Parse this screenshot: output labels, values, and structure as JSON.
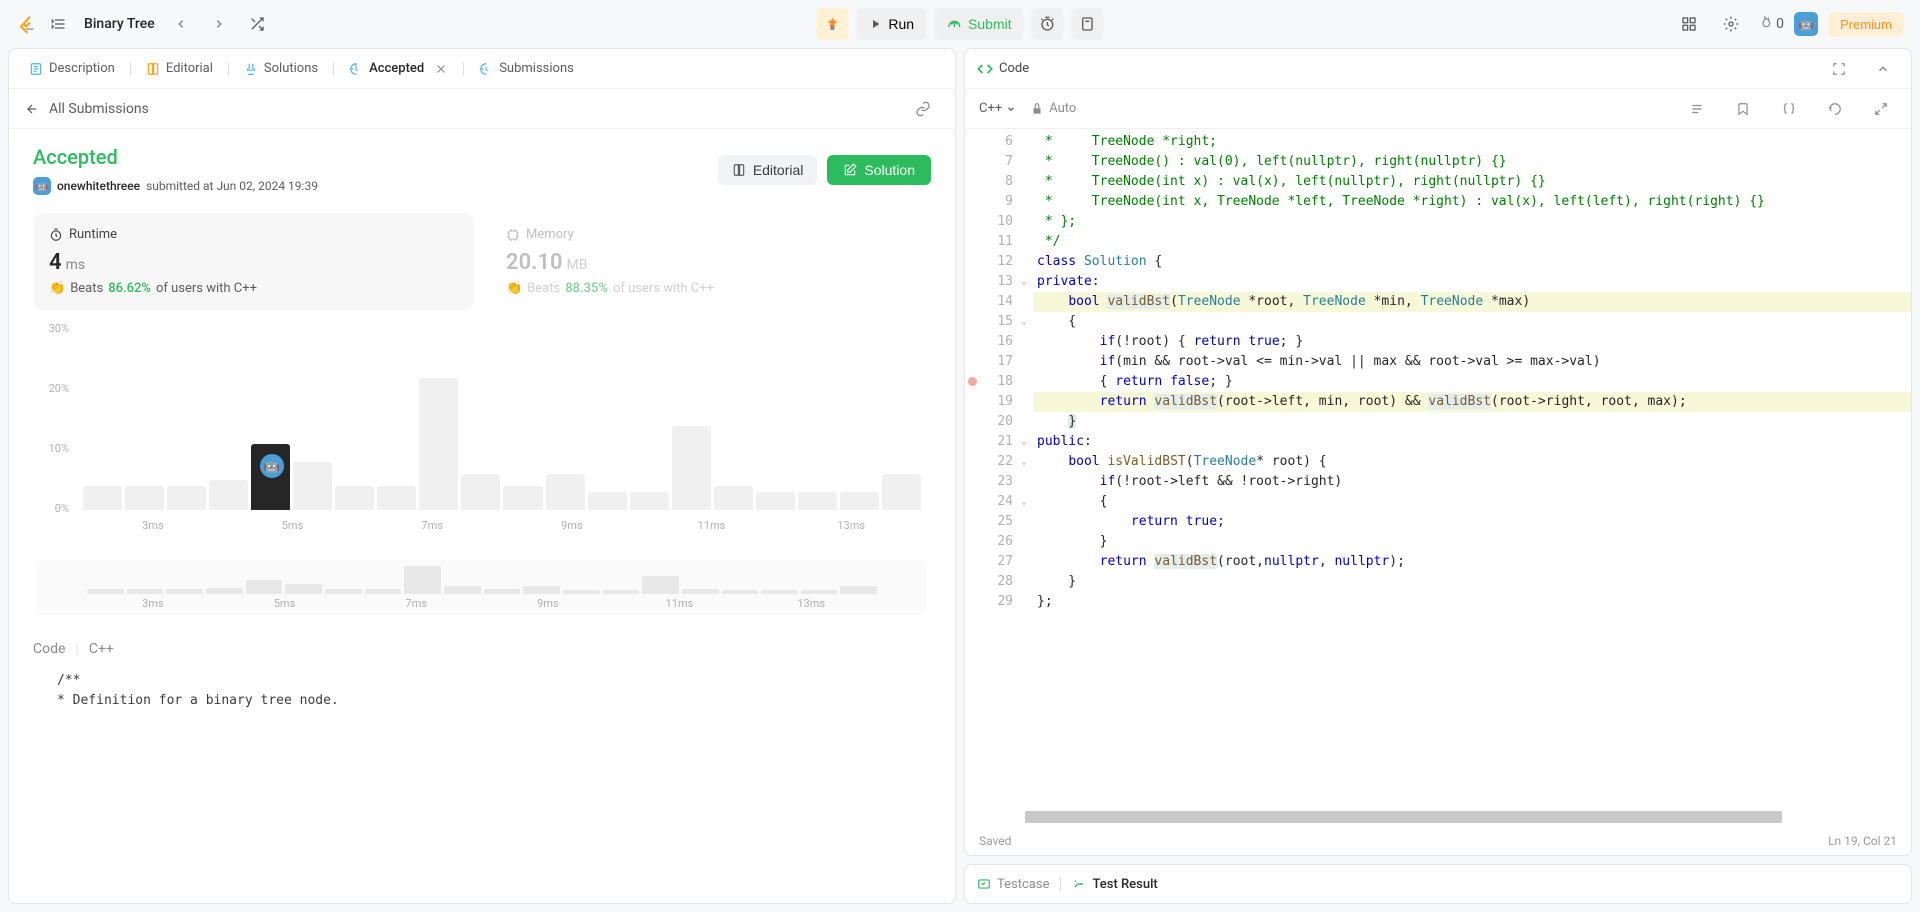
{
  "topbar": {
    "problem_title": "Binary Tree",
    "run_label": "Run",
    "submit_label": "Submit",
    "fire_count": "0",
    "premium_label": "Premium"
  },
  "left": {
    "tabs": {
      "description": "Description",
      "editorial": "Editorial",
      "solutions": "Solutions",
      "accepted": "Accepted",
      "submissions": "Submissions"
    },
    "back_label": "All Submissions",
    "status_title": "Accepted",
    "username": "onewhitethreee",
    "submitted_at": "submitted at Jun 02, 2024 19:39",
    "editorial_btn": "Editorial",
    "solution_btn": "Solution",
    "runtime": {
      "label": "Runtime",
      "value": "4",
      "unit": "ms",
      "beats_label": "Beats",
      "pct": "86.62%",
      "of_users": "of users with C++"
    },
    "memory": {
      "label": "Memory",
      "value": "20.10",
      "unit": "MB",
      "beats_label": "Beats",
      "pct": "88.35%",
      "of_users": "of users with C++"
    },
    "code_label": "Code",
    "lang_label": "C++",
    "snippet_l1": "/**",
    "snippet_l2": " * Definition for a binary tree node."
  },
  "chart_data": {
    "type": "bar",
    "xlabel_unit": "ms",
    "y_ticks": [
      "0%",
      "10%",
      "20%",
      "30%"
    ],
    "x_ticks": [
      "3ms",
      "5ms",
      "7ms",
      "9ms",
      "11ms",
      "13ms"
    ],
    "bars_pct": [
      4,
      4,
      4,
      5,
      11,
      8,
      4,
      4,
      22,
      6,
      4,
      6,
      3,
      3,
      14,
      4,
      3,
      3,
      3,
      6
    ],
    "highlight_index": 4,
    "user_marker_position_index": 4
  },
  "right": {
    "code_title": "Code",
    "lang": "C++",
    "auto_label": "Auto",
    "footer_saved": "Saved",
    "footer_pos": "Ln 19, Col 21",
    "testcase_tab": "Testcase",
    "result_tab": "Test Result",
    "start_line": 6,
    "lines": [
      {
        "t": " *     TreeNode *right;",
        "c": "cm"
      },
      {
        "t": " *     TreeNode() : val(0), left(nullptr), right(nullptr) {}",
        "c": "cm"
      },
      {
        "t": " *     TreeNode(int x) : val(x), left(nullptr), right(nullptr) {}",
        "c": "cm"
      },
      {
        "t": " *     TreeNode(int x, TreeNode *left, TreeNode *right) : val(x), left(left), right(right) {}",
        "c": "cm"
      },
      {
        "t": " * };",
        "c": "cm"
      },
      {
        "t": " */",
        "c": "cm"
      },
      {
        "html": "<span class='kw'>class</span> <span class='type'>Solution</span> {"
      },
      {
        "html": "<span class='kw'>private</span>:",
        "fold": true
      },
      {
        "html": "    <span class='kw'>bool</span> <span class='fn hl-word'>validBst</span>(<span class='type'>TreeNode</span> *root, <span class='type'>TreeNode</span> *min, <span class='type'>TreeNode</span> *max)",
        "hl": true
      },
      {
        "t": "    {",
        "fold": true
      },
      {
        "html": "        <span class='kw'>if</span>(!root) { <span class='kw'>return</span> <span class='kw'>true</span>; }"
      },
      {
        "html": "        <span class='kw'>if</span>(min && root-&gt;val &lt;= min-&gt;val || max && root-&gt;val &gt;= max-&gt;val)"
      },
      {
        "html": "        { <span class='kw'>return</span> <span class='kw'>false</span>; }",
        "bp": true
      },
      {
        "html": "        <span class='kw'>return</span> <span class='fn hl-word'>validBst</span>(root-&gt;left, min, root) && <span class='fn hl-word'>validBst</span>(root-&gt;right, root, max);",
        "hl": true
      },
      {
        "html": "    <span class='hl-word'>}</span>"
      },
      {
        "html": "<span class='kw'>public</span>:",
        "fold": true
      },
      {
        "html": "    <span class='kw'>bool</span> <span class='fn'>isValidBST</span>(<span class='type'>TreeNode</span>* root) {",
        "fold": true
      },
      {
        "html": "        <span class='kw'>if</span>(!root-&gt;left && !root-&gt;right)"
      },
      {
        "t": "        {",
        "fold": true
      },
      {
        "html": "            <span class='kw'>return</span> <span class='kw'>true</span>;"
      },
      {
        "t": "        }"
      },
      {
        "html": "        <span class='kw'>return</span> <span class='fn hl-word'>validBst</span>(root,<span class='kw'>nullptr</span>, <span class='kw'>nullptr</span>);"
      },
      {
        "t": "    }"
      },
      {
        "t": "};"
      }
    ]
  }
}
